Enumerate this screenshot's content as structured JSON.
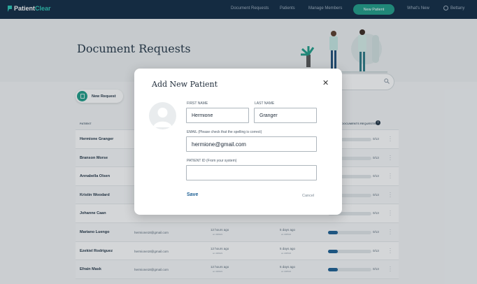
{
  "brand": {
    "name_a": "Patient",
    "name_b": "Clear"
  },
  "nav": {
    "links": [
      "Document Requests",
      "Patients",
      "Manage Members"
    ],
    "cta": "New Patient",
    "whats_new": "What's New",
    "user": "Bettany"
  },
  "page": {
    "title": "Document  Requests",
    "new_request": "New Request"
  },
  "table": {
    "headers": {
      "patient": "PATIENT",
      "documents": "DOCUMENTS REQUESTED"
    },
    "rows": [
      {
        "name": "Hermione Granger",
        "email": "",
        "t1": "",
        "t1_sub": "",
        "t2": "",
        "t2_sub": "",
        "progress": 0,
        "progress_label": "0/13"
      },
      {
        "name": "Branson Morse",
        "email": "",
        "t1": "",
        "t1_sub": "",
        "t2": "",
        "t2_sub": "",
        "progress": 0,
        "progress_label": "0/13"
      },
      {
        "name": "Annabella Olsen",
        "email": "",
        "t1": "",
        "t1_sub": "",
        "t2": "",
        "t2_sub": "",
        "progress": 0,
        "progress_label": "0/13"
      },
      {
        "name": "Kristin Woodard",
        "email": "",
        "t1": "",
        "t1_sub": "",
        "t2": "",
        "t2_sub": "",
        "progress": 0,
        "progress_label": "0/13"
      },
      {
        "name": "Johanne Caan",
        "email": "",
        "t1": "",
        "t1_sub": "",
        "t2": "",
        "t2_sub": "",
        "progress": 0,
        "progress_label": "0/13"
      },
      {
        "name": "Mariano Luengo",
        "email": "hermione18@gmail.com",
        "t1": "12 hours ago",
        "t1_sub": "on 4/29/21",
        "t2": "5 days ago",
        "t2_sub": "on 4/25/21",
        "progress": 0.23,
        "progress_label": "0/13"
      },
      {
        "name": "Ezekiel Rodriguez",
        "email": "hermione18@gmail.com",
        "t1": "12 hours ago",
        "t1_sub": "on 4/29/21",
        "t2": "5 days ago",
        "t2_sub": "on 4/25/21",
        "progress": 0.23,
        "progress_label": "0/13"
      },
      {
        "name": "Efrain Mask",
        "email": "hermione18@gmail.com",
        "t1": "12 hours ago",
        "t1_sub": "on 4/29/21",
        "t2": "5 days ago",
        "t2_sub": "on 4/25/21",
        "progress": 0.23,
        "progress_label": "0/13"
      }
    ]
  },
  "modal": {
    "title": "Add New Patient",
    "first_name_label": "FIRST NAME",
    "first_name_value": "Hermione",
    "last_name_label": "LAST NAME",
    "last_name_value": "Granger",
    "email_label": "EMAIL (Please check that the spelling is correct)",
    "email_value": "hermione@gmail.com",
    "patient_id_label": "PATIENT ID (From your system)",
    "patient_id_value": "",
    "save": "Save",
    "cancel": "Cancel"
  },
  "colors": {
    "navy": "#102a43",
    "accent": "#1f9d88",
    "link": "#1c5f93"
  }
}
